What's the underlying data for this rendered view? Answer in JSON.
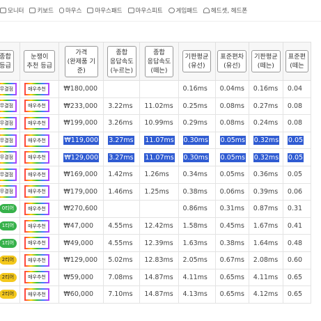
{
  "nav": [
    "모니터",
    "키보드",
    "마우스",
    "마우스패드",
    "마우스피트",
    "게임패드",
    "헤드셋, 헤드폰"
  ],
  "headers": [
    "종합\n등급",
    "눈쟁이\n추천 등급",
    "가격\n(완제품 기\n준)",
    "종합\n응답속도\n(누르는)",
    "종합\n응답속도\n(떼는)",
    "기판평균\n(유선)",
    "표준편차\n(유선)",
    "기판평균\n(떼는)",
    "표준편\n(떼는"
  ],
  "rows": [
    {
      "grade": "무결점",
      "rec": "매우추천",
      "price": "₩180,000",
      "press": "",
      "release": "",
      "avg_wired": "0.16ms",
      "sd_wired": "0.04ms",
      "avg_release": "0.16ms",
      "sd_release": "0.04",
      "selected": false
    },
    {
      "grade": "무결점",
      "rec": "매우추천",
      "price": "₩233,000",
      "press": "3.22ms",
      "release": "11.02ms",
      "avg_wired": "0.25ms",
      "sd_wired": "0.08ms",
      "avg_release": "0.27ms",
      "sd_release": "0.08",
      "selected": false
    },
    {
      "grade": "무결점",
      "rec": "매우추천",
      "price": "₩199,000",
      "press": "3.26ms",
      "release": "10.99ms",
      "avg_wired": "0.29ms",
      "sd_wired": "0.08ms",
      "avg_release": "0.24ms",
      "sd_release": "0.08",
      "selected": false
    },
    {
      "grade": "무결점",
      "rec": "매우추천",
      "price": "₩119,000",
      "press": "3.27ms",
      "release": "11.07ms",
      "avg_wired": "0.30ms",
      "sd_wired": "0.05ms",
      "avg_release": "0.32ms",
      "sd_release": "0.05",
      "selected": true
    },
    {
      "grade": "무결점",
      "rec": "매우추천",
      "price": "₩129,000",
      "press": "3.27ms",
      "release": "11.07ms",
      "avg_wired": "0.30ms",
      "sd_wired": "0.05ms",
      "avg_release": "0.32ms",
      "sd_release": "0.05",
      "selected": true
    },
    {
      "grade": "무결점",
      "rec": "매우추천",
      "price": "₩169,000",
      "press": "1.42ms",
      "release": "1.26ms",
      "avg_wired": "0.34ms",
      "sd_wired": "0.05ms",
      "avg_release": "0.36ms",
      "sd_release": "0.05",
      "selected": false
    },
    {
      "grade": "무결점",
      "rec": "매우추천",
      "price": "₩179,000",
      "press": "1.46ms",
      "release": "1.25ms",
      "avg_wired": "0.38ms",
      "sd_wired": "0.06ms",
      "avg_release": "0.39ms",
      "sd_release": "0.06",
      "selected": false
    },
    {
      "grade": "0티어",
      "rec": "매우추천",
      "price": "₩270,600",
      "press": "",
      "release": "",
      "avg_wired": "0.86ms",
      "sd_wired": "0.31ms",
      "avg_release": "0.87ms",
      "sd_release": "0.31",
      "selected": false
    },
    {
      "grade": "1티어",
      "rec": "매우추천",
      "price": "₩47,000",
      "press": "4.55ms",
      "release": "12.42ms",
      "avg_wired": "1.58ms",
      "sd_wired": "0.45ms",
      "avg_release": "1.67ms",
      "sd_release": "0.41",
      "selected": false
    },
    {
      "grade": "1티어",
      "rec": "매우추천",
      "price": "₩49,000",
      "press": "4.55ms",
      "release": "12.39ms",
      "avg_wired": "1.63ms",
      "sd_wired": "0.38ms",
      "avg_release": "1.64ms",
      "sd_release": "0.48",
      "selected": false
    },
    {
      "grade": "2티어",
      "rec": "매우추천",
      "price": "₩129,000",
      "press": "5.02ms",
      "release": "12.83ms",
      "avg_wired": "2.05ms",
      "sd_wired": "0.67ms",
      "avg_release": "2.08ms",
      "sd_release": "0.60",
      "selected": false
    },
    {
      "grade": "2티어",
      "rec": "매우추천",
      "price": "₩59,000",
      "press": "7.08ms",
      "release": "14.87ms",
      "avg_wired": "4.11ms",
      "sd_wired": "0.65ms",
      "avg_release": "4.11ms",
      "sd_release": "0.65",
      "selected": false
    },
    {
      "grade": "2티어",
      "rec": "매우추천",
      "price": "₩60,000",
      "press": "7.10ms",
      "release": "14.87ms",
      "avg_wired": "4.13ms",
      "sd_wired": "0.65ms",
      "avg_release": "4.12ms",
      "sd_release": "0.65",
      "selected": false
    }
  ]
}
